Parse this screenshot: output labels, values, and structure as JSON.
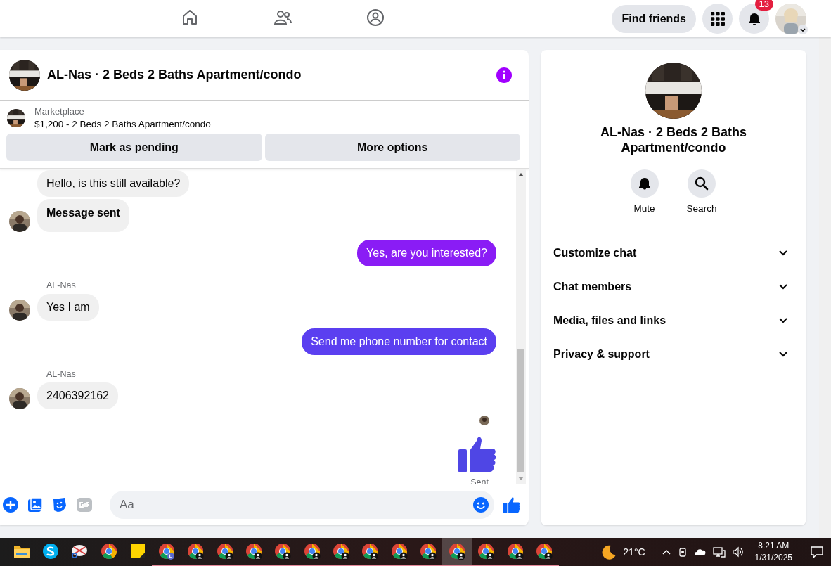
{
  "top_bar": {
    "nav": [
      {
        "kind": "home",
        "selected": false
      },
      {
        "kind": "friends",
        "selected": false
      },
      {
        "kind": "groups",
        "selected": false
      }
    ],
    "find_friends": "Find friends",
    "notifications_badge": "13"
  },
  "chat": {
    "title": "AL-Nas · 2 Beds 2 Baths Apartment/condo",
    "marketplace": {
      "label": "Marketplace",
      "listing": "$1,200 - 2 Beds 2 Baths Apartment/condo"
    },
    "actions": [
      "Mark as pending",
      "More options"
    ],
    "messages": [
      {
        "kind": "incoming",
        "text": "Hello, is this still available?",
        "avatar": false
      },
      {
        "kind": "incoming",
        "text": "Message sent",
        "bold": true,
        "avatar": true
      },
      {
        "kind": "outgoing",
        "text": "Yes, are you interested?",
        "color": "#8a1cf5"
      },
      {
        "kind": "incoming",
        "sender": "AL-Nas",
        "text": "Yes I am",
        "avatar": true
      },
      {
        "kind": "outgoing",
        "text": "Send me phone number for contact",
        "color": "#5b3ff0"
      },
      {
        "kind": "incoming",
        "sender": "AL-Nas",
        "text": "2406392162",
        "avatar": true
      },
      {
        "kind": "like",
        "status": "Sent"
      }
    ],
    "composer": {
      "placeholder": "Aa"
    }
  },
  "details": {
    "title": "AL-Nas · 2 Beds 2 Baths Apartment/condo",
    "actions": [
      {
        "kind": "mute",
        "label": "Mute"
      },
      {
        "kind": "search",
        "label": "Search"
      }
    ],
    "sections": [
      {
        "label": "Customize chat",
        "expanded": false
      },
      {
        "label": "Chat members",
        "expanded": false
      },
      {
        "label": "Media, files and links",
        "expanded": false
      },
      {
        "label": "Privacy & support",
        "expanded": false
      }
    ]
  },
  "taskbar": {
    "apps": [
      {
        "kind": "folder",
        "running": false,
        "selected": false
      },
      {
        "kind": "skype",
        "running": false,
        "selected": false
      },
      {
        "kind": "snip",
        "running": false,
        "selected": false
      },
      {
        "kind": "chrome",
        "running": false,
        "selected": false
      },
      {
        "kind": "notes",
        "running": false,
        "selected": false
      },
      {
        "kind": "chrome-l",
        "running": true,
        "selected": false
      },
      {
        "kind": "chrome-p",
        "running": true,
        "selected": false
      },
      {
        "kind": "chrome-p",
        "running": true,
        "selected": false
      },
      {
        "kind": "chrome-p",
        "running": true,
        "selected": false
      },
      {
        "kind": "chrome-p",
        "running": true,
        "selected": false
      },
      {
        "kind": "chrome-p",
        "running": true,
        "selected": false
      },
      {
        "kind": "chrome-p",
        "running": true,
        "selected": false
      },
      {
        "kind": "chrome-p",
        "running": true,
        "selected": false
      },
      {
        "kind": "chrome-p",
        "running": true,
        "selected": false
      },
      {
        "kind": "chrome-p",
        "running": true,
        "selected": false
      },
      {
        "kind": "chrome-p",
        "running": true,
        "selected": true
      },
      {
        "kind": "chrome-p",
        "running": true,
        "selected": false
      },
      {
        "kind": "chrome-p",
        "running": true,
        "selected": false
      },
      {
        "kind": "chrome-p",
        "running": true,
        "selected": false
      }
    ],
    "temperature": "21°C",
    "time": "8:21 AM",
    "date": "1/31/2025"
  }
}
